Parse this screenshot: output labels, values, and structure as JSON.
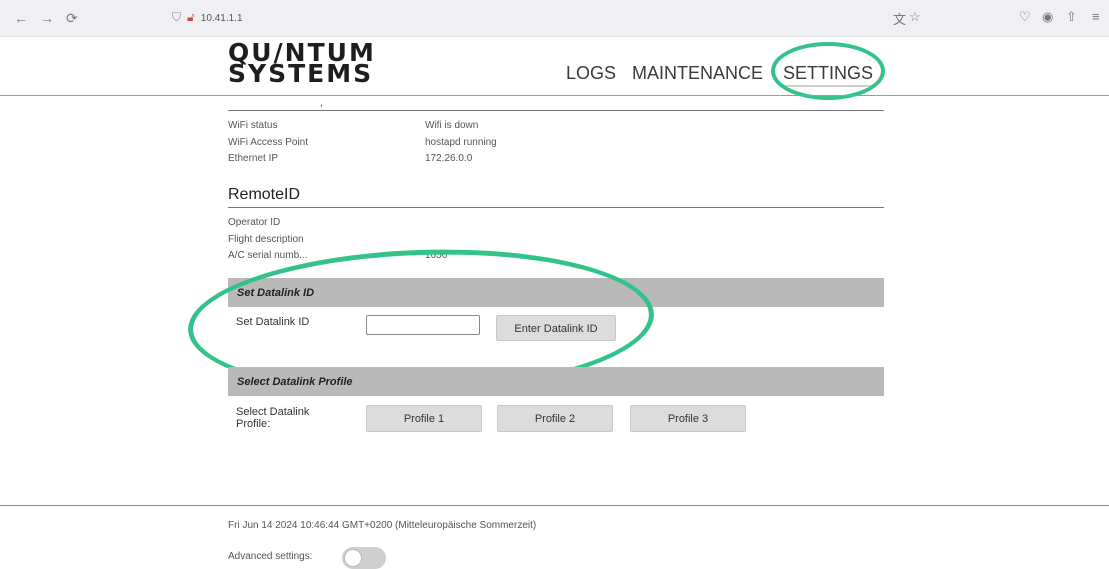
{
  "browser": {
    "url": "10.41.1.1",
    "icons": [
      "back-icon",
      "forward-icon",
      "reload-icon",
      "shield-icon",
      "lock-icon",
      "translate-icon",
      "star-icon",
      "pocket-icon",
      "account-icon",
      "extensions-icon",
      "menu-icon"
    ]
  },
  "header": {
    "logo_line1": "QU/NTUM",
    "logo_line2": "SYSTEMS",
    "nav": [
      "LOGS",
      "MAINTENANCE",
      "SETTINGS"
    ],
    "active_nav": "SETTINGS",
    "annotation_color": "#33c28a"
  },
  "network": {
    "rows": [
      {
        "label": "WiFi status",
        "value": "Wifi is down"
      },
      {
        "label": "WiFi Access Point",
        "value": "hostapd running"
      },
      {
        "label": "Ethernet IP",
        "value": "172.26.0.0"
      }
    ]
  },
  "remoteid": {
    "title": "RemoteID",
    "rows": [
      {
        "label": "Operator ID",
        "value": ""
      },
      {
        "label": "Flight description",
        "value": ""
      },
      {
        "label": "A/C serial numb...",
        "value": "1656"
      }
    ]
  },
  "datalink_id": {
    "bar_title": "Set Datalink ID",
    "label": "Set Datalink ID",
    "input_value": "",
    "button_label": "Enter Datalink ID"
  },
  "datalink_profile": {
    "bar_title": "Select Datalink Profile",
    "label_line1": "Select Datalink",
    "label_line2": "Profile:",
    "buttons": [
      "Profile 1",
      "Profile 2",
      "Profile 3"
    ]
  },
  "footer": {
    "datetime": "Fri Jun 14 2024 10:46:44 GMT+0200 (Mitteleuropäische Sommerzeit)",
    "advanced_label": "Advanced settings:",
    "advanced_enabled": false
  }
}
